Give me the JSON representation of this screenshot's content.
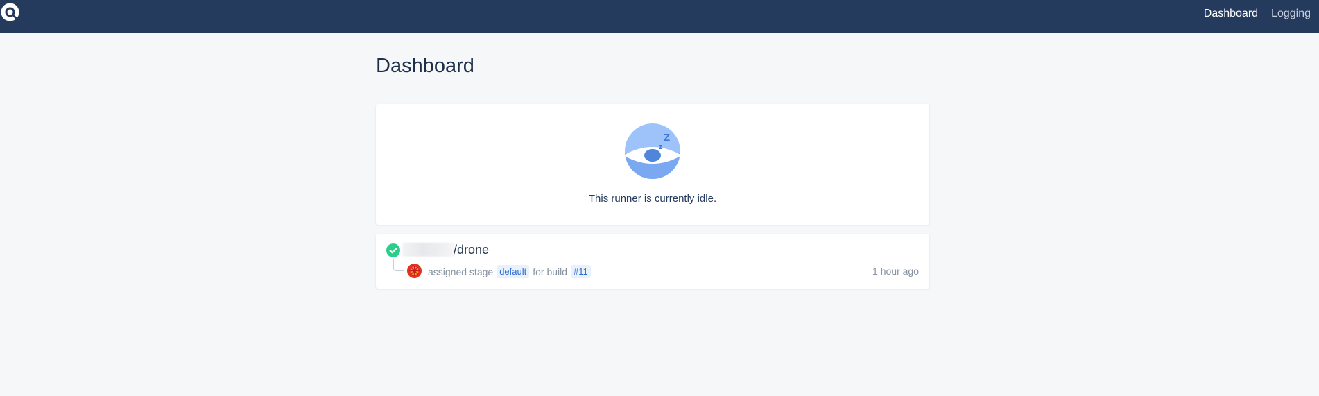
{
  "nav": {
    "items": [
      {
        "label": "Dashboard"
      },
      {
        "label": "Logging"
      }
    ]
  },
  "page": {
    "title": "Dashboard"
  },
  "idle": {
    "message": "This runner is currently idle."
  },
  "builds": [
    {
      "repo": "/drone",
      "status": "success",
      "action": "assigned stage",
      "stage": "default",
      "for_text": "for build",
      "build_number": "#11",
      "time_ago": "1 hour ago"
    }
  ],
  "colors": {
    "topbar": "#253b5e",
    "success": "#2ecc8a",
    "accent": "#2f6ccf"
  }
}
